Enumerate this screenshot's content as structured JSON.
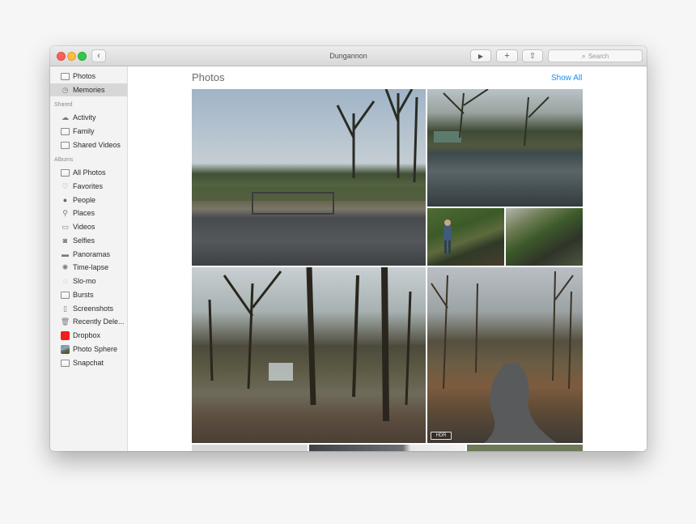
{
  "window": {
    "title": "Dungannon"
  },
  "toolbar": {
    "back_glyph": "‹",
    "play_glyph": "▶",
    "add_glyph": "+",
    "share_glyph": "⇧",
    "search_placeholder": "Search",
    "search_icon": "search-icon"
  },
  "sidebar": {
    "top_items": [
      {
        "label": "Photos",
        "icon": "photos-icon",
        "selected": false
      },
      {
        "label": "Memories",
        "icon": "memories-icon",
        "selected": true
      }
    ],
    "shared_header": "Shared",
    "shared_items": [
      {
        "label": "Activity",
        "icon": "cloud-icon"
      },
      {
        "label": "Family",
        "icon": "album-icon"
      },
      {
        "label": "Shared Videos",
        "icon": "album-icon"
      }
    ],
    "albums_header": "Albums",
    "album_items": [
      {
        "label": "All Photos",
        "icon": "album-icon"
      },
      {
        "label": "Favorites",
        "icon": "heart-icon"
      },
      {
        "label": "People",
        "icon": "person-icon"
      },
      {
        "label": "Places",
        "icon": "pin-icon"
      },
      {
        "label": "Videos",
        "icon": "video-icon"
      },
      {
        "label": "Selfies",
        "icon": "camera-icon"
      },
      {
        "label": "Panoramas",
        "icon": "panorama-icon"
      },
      {
        "label": "Time-lapse",
        "icon": "timelapse-icon"
      },
      {
        "label": "Slo-mo",
        "icon": "slomo-icon"
      },
      {
        "label": "Bursts",
        "icon": "bursts-icon"
      },
      {
        "label": "Screenshots",
        "icon": "screenshot-icon"
      },
      {
        "label": "Recently Dele...",
        "icon": "trash-icon"
      },
      {
        "label": "Dropbox",
        "icon": "dropbox-album-icon",
        "color": "#f41c1c"
      },
      {
        "label": "Photo Sphere",
        "icon": "photo-sphere-icon"
      },
      {
        "label": "Snapchat",
        "icon": "album-icon"
      }
    ]
  },
  "main": {
    "section_title": "Photos",
    "show_all": "Show All",
    "hdr_badge": "HDR",
    "accent_color": "#1a8cf0"
  }
}
